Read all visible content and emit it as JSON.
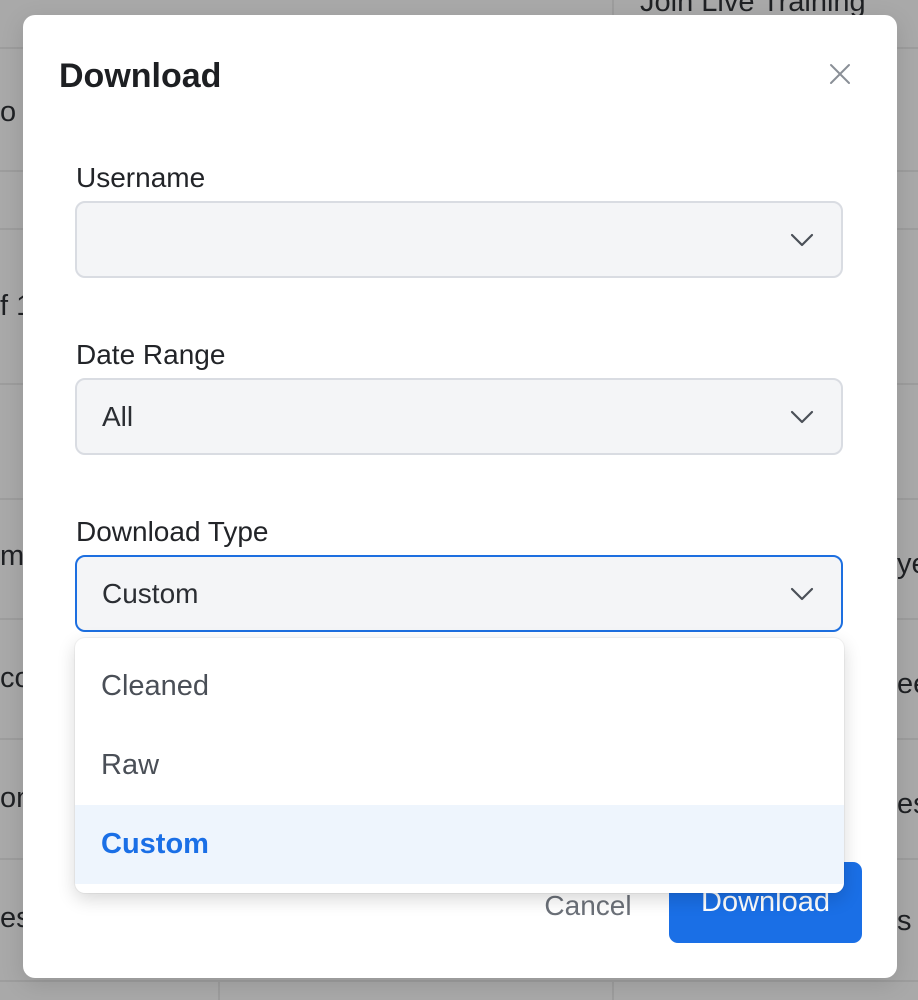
{
  "background": {
    "top_button_label": "Join Live Training",
    "left_fragments": [
      "o",
      "f 1",
      "m",
      "co",
      "om",
      "es"
    ],
    "right_fragments": [
      "ye",
      "ee",
      "es",
      "s"
    ]
  },
  "modal": {
    "title": "Download",
    "close_icon": "close-icon",
    "fields": {
      "username": {
        "label": "Username",
        "value": ""
      },
      "date_range": {
        "label": "Date Range",
        "value": "All"
      },
      "download_type": {
        "label": "Download Type",
        "value": "Custom"
      }
    },
    "dropdown": {
      "options": [
        "Cleaned",
        "Raw",
        "Custom"
      ],
      "selected": "Custom"
    },
    "buttons": {
      "cancel": "Cancel",
      "download": "Download"
    }
  },
  "colors": {
    "accent": "#1a6fe6",
    "selected_option_bg": "#eef5fd",
    "overlay": "#a9a9a9"
  }
}
